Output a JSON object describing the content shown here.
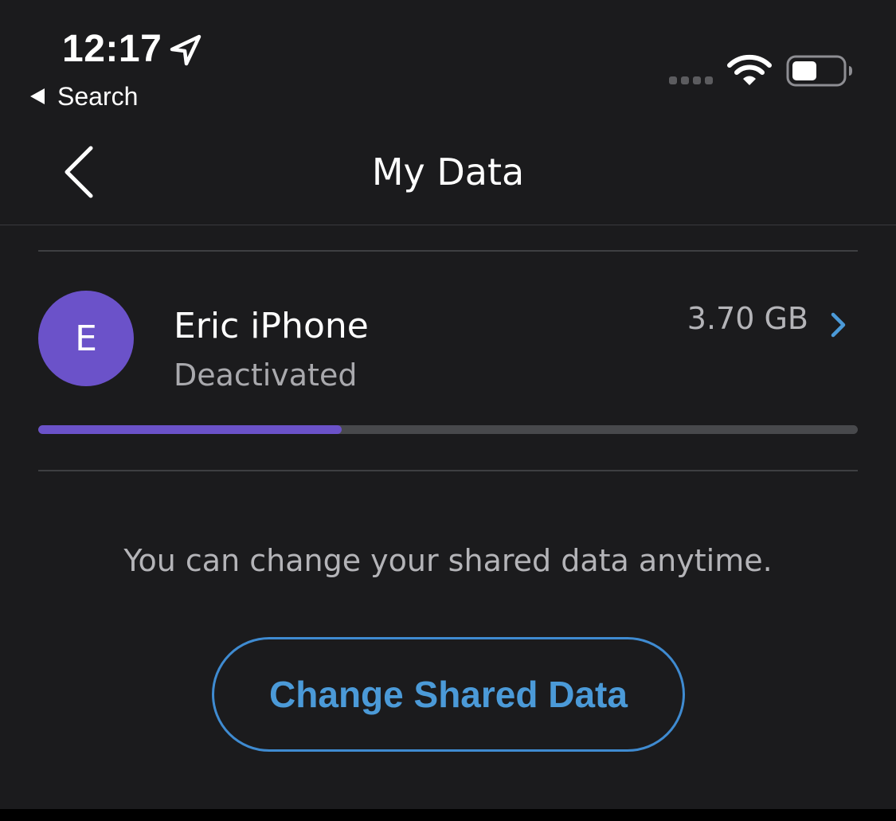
{
  "status_bar": {
    "time": "12:17",
    "back_to_app_label": "Search",
    "icons": [
      "location-arrow-icon",
      "signal-dots-icon",
      "wifi-icon",
      "battery-icon"
    ]
  },
  "nav": {
    "title": "My Data",
    "back_icon": "chevron-left-icon"
  },
  "member": {
    "avatar_initial": "E",
    "name": "Eric iPhone",
    "status": "Deactivated",
    "usage": "3.70 GB",
    "usage_fraction": 0.37
  },
  "info_text": "You can change your shared data anytime.",
  "cta_label": "Change Shared Data",
  "colors": {
    "background": "#1b1b1d",
    "accent_purple": "#6b52c9",
    "accent_blue": "#4b9ad8",
    "track": "#48494c"
  }
}
